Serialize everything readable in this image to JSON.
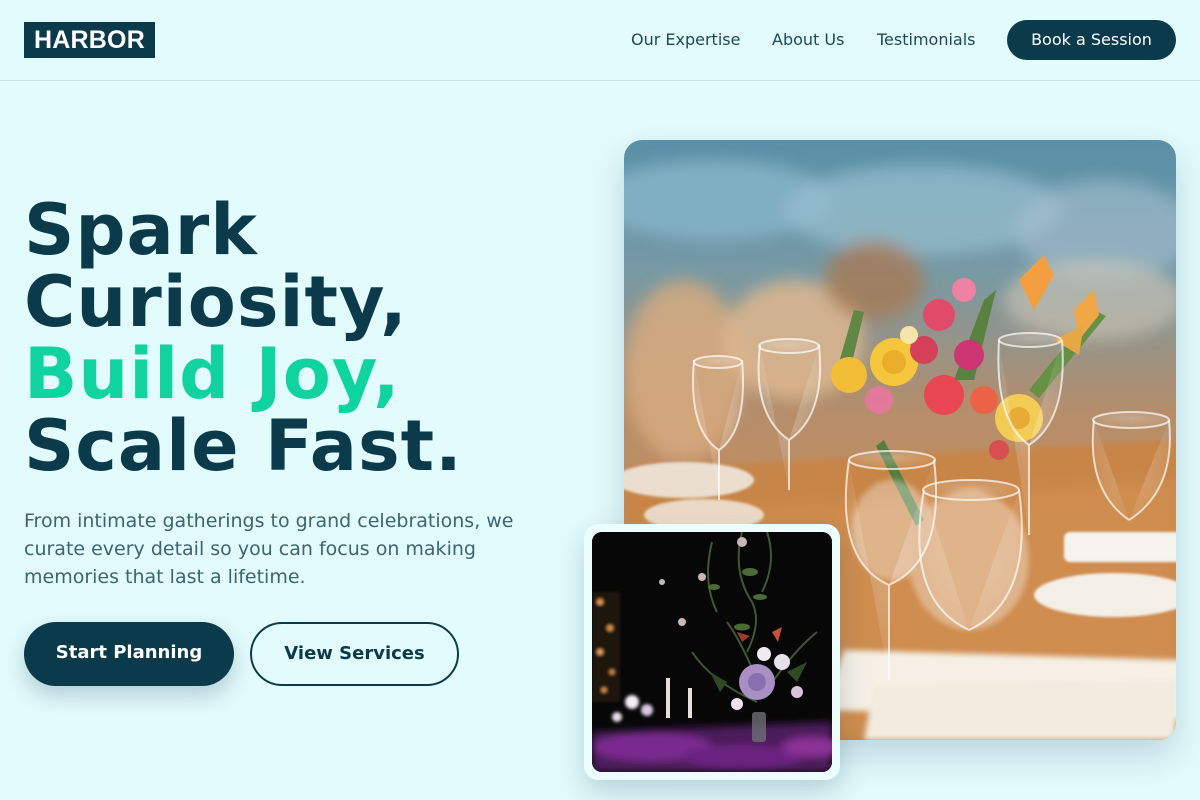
{
  "brand": {
    "logo": "HARBOR"
  },
  "nav": {
    "links": [
      "Our Expertise",
      "About Us",
      "Testimonials"
    ],
    "cta": "Book a Session"
  },
  "hero": {
    "headline": [
      "Spark",
      "Curiosity,",
      "Build Joy,",
      "Scale Fast."
    ],
    "subtext": "From intimate gatherings to grand celebrations, we curate every detail so you can focus on making memories that last a lifetime.",
    "primary_button": "Start Planning",
    "secondary_button": "View Services"
  },
  "images": {
    "main": "table-setting-with-flowers-photo",
    "secondary": "dark-floral-centerpiece-photo"
  },
  "colors": {
    "primary": "#0b3a4b",
    "accent": "#10d3a0",
    "background": "#e2fbfd"
  }
}
